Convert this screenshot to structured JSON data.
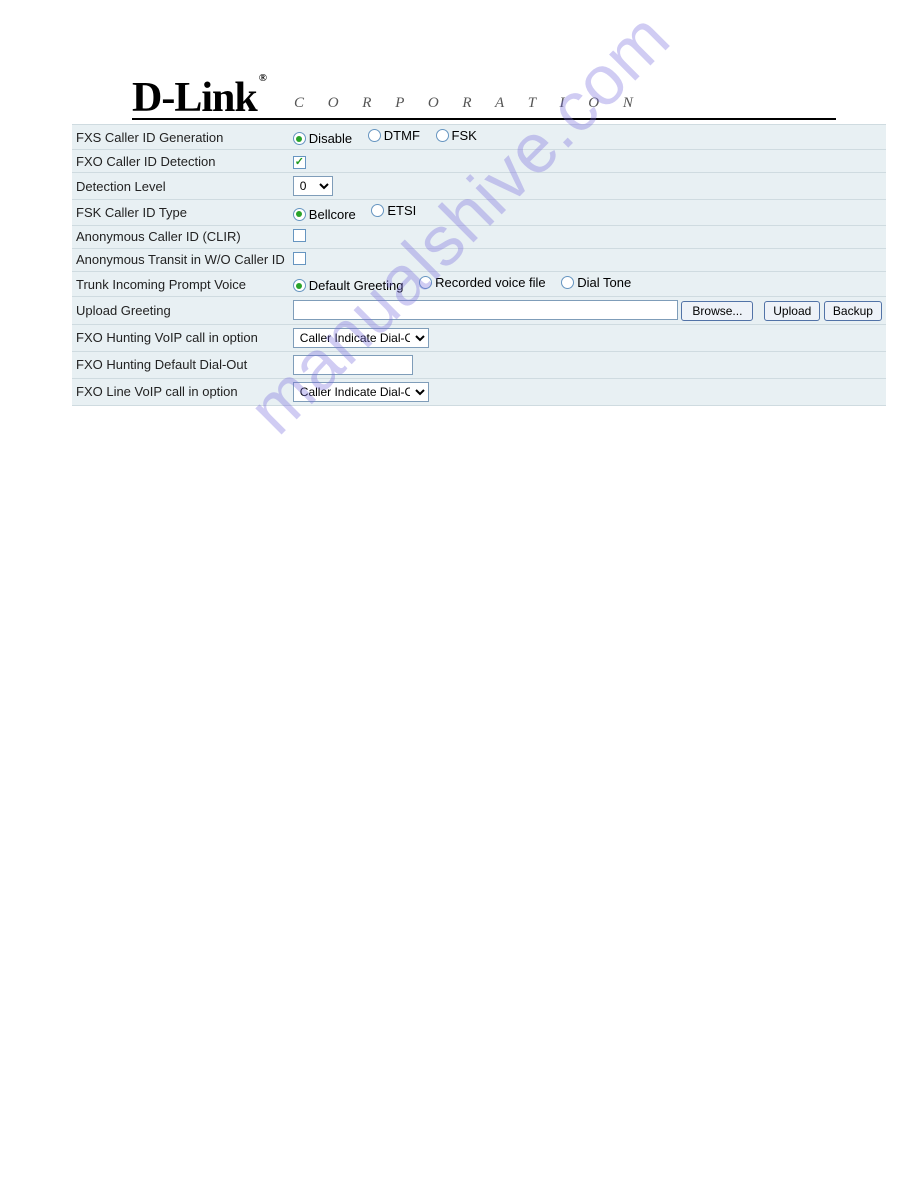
{
  "brand": {
    "name": "D-Link",
    "reg": "®",
    "subtitle": "C O R P O R A T I O N"
  },
  "rows": {
    "fxs_gen": {
      "label": "FXS Caller ID Generation",
      "opts": {
        "disable": "Disable",
        "dtmf": "DTMF",
        "fsk": "FSK"
      }
    },
    "fxo_det": {
      "label": "FXO Caller ID Detection"
    },
    "det_level": {
      "label": "Detection Level",
      "value": "0"
    },
    "fsk_type": {
      "label": "FSK Caller ID Type",
      "opts": {
        "bellcore": "Bellcore",
        "etsi": "ETSI"
      }
    },
    "anon_clir": {
      "label": "Anonymous Caller ID (CLIR)"
    },
    "anon_transit": {
      "label": "Anonymous Transit in W/O Caller ID"
    },
    "trunk_prompt": {
      "label": "Trunk Incoming Prompt Voice",
      "opts": {
        "default": "Default Greeting",
        "recorded": "Recorded voice file",
        "dial": "Dial Tone"
      }
    },
    "upload_greet": {
      "label": "Upload Greeting",
      "browse": "Browse...",
      "upload": "Upload",
      "backup": "Backup"
    },
    "fxo_hunt_opt": {
      "label": "FXO Hunting VoIP call in option",
      "value": "Caller Indicate Dial-Out"
    },
    "fxo_hunt_def": {
      "label": "FXO Hunting Default Dial-Out"
    },
    "fxo_line_opt": {
      "label": "FXO Line VoIP call in option",
      "value": "Caller Indicate Dial-Out"
    }
  },
  "watermark": "manualshive.com"
}
